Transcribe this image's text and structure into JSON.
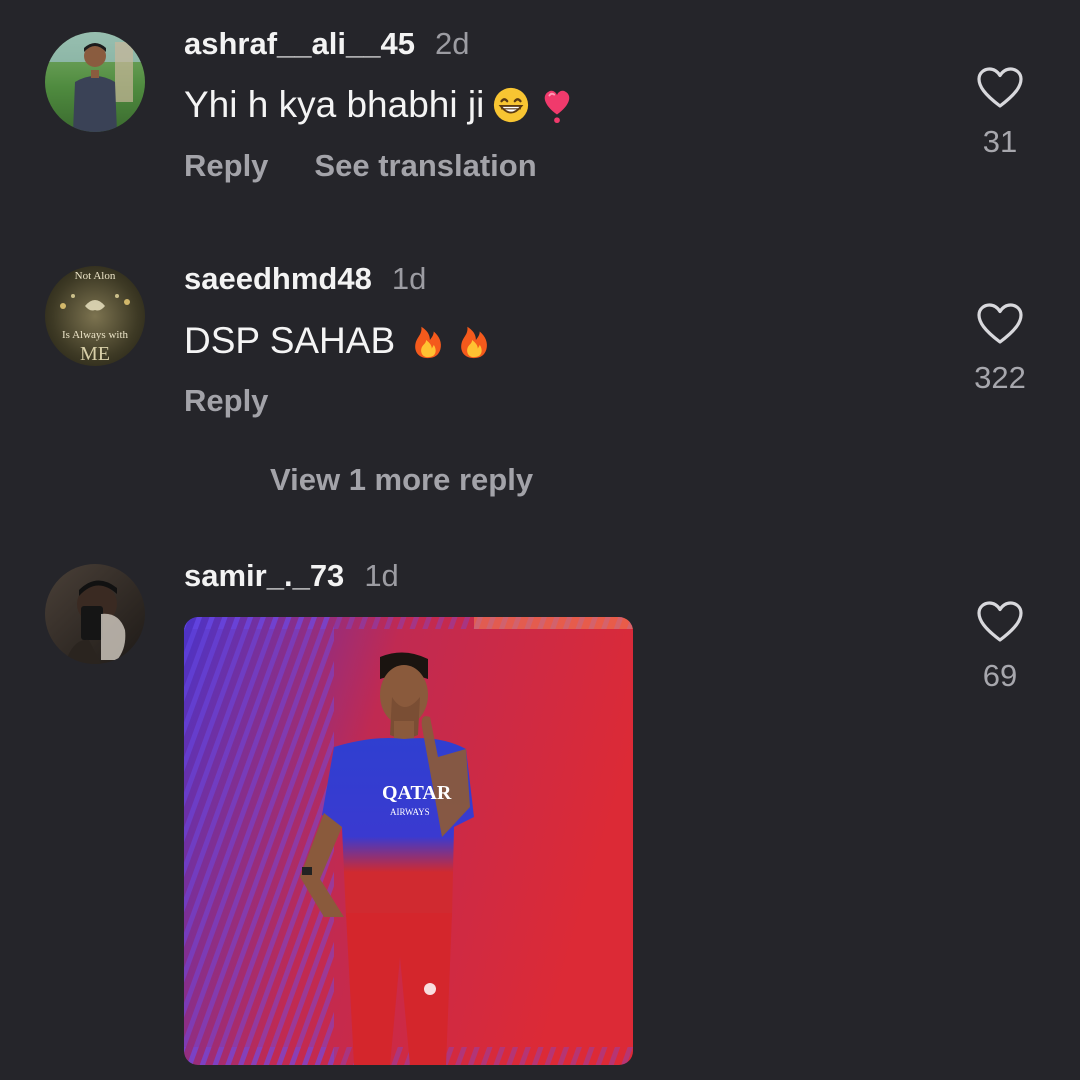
{
  "comments": [
    {
      "username": "ashraf__ali__45",
      "time": "2d",
      "text": "Yhi h kya bhabhi ji",
      "emojis": [
        "grinning-face-icon",
        "heart-exclamation-icon"
      ],
      "actions": [
        "Reply",
        "See translation"
      ],
      "likes": "31"
    },
    {
      "username": "saeedhmd48",
      "time": "1d",
      "text": "DSP SAHAB",
      "emojis": [
        "fire-icon",
        "fire-icon"
      ],
      "actions": [
        "Reply"
      ],
      "likes": "322",
      "avatar_text": {
        "top": "Not Alon",
        "middle": "Is Always with",
        "bottom": "ME"
      },
      "view_more": "View 1 more reply"
    },
    {
      "username": "samir_._73",
      "time": "1d",
      "media": {
        "type": "gif",
        "jersey_text": "QATAR",
        "jersey_subtext": "AIRWAYS"
      },
      "likes": "69"
    }
  ],
  "colors": {
    "background": "#25252a",
    "text_primary": "#f3f3f3",
    "text_secondary": "#a3a3a9",
    "media_red": "#d8263a",
    "media_blue": "#3b3fd1"
  }
}
